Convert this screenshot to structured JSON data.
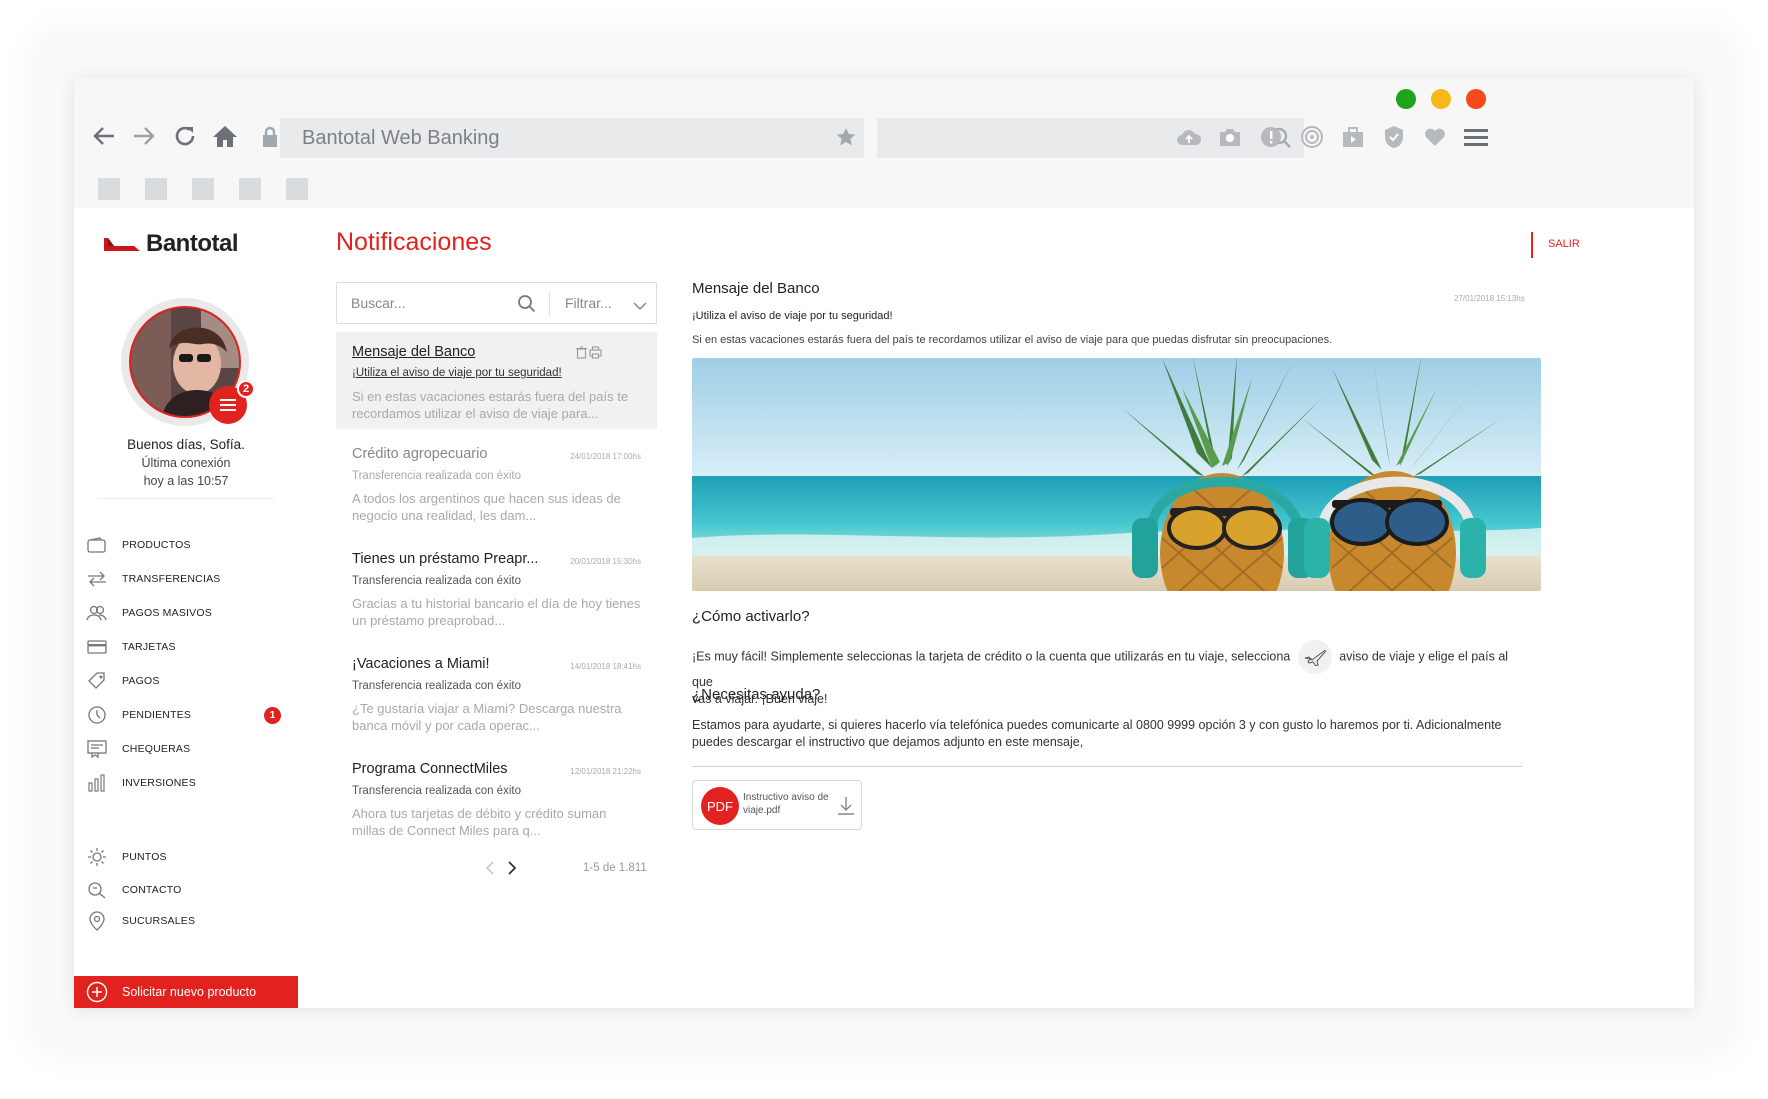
{
  "browser": {
    "address": "Bantotal Web Banking",
    "window_buttons": [
      "#1ea31e",
      "#f6b919",
      "#f54a1a"
    ]
  },
  "app": {
    "brand": "Bantotal",
    "accent": "#e2221e",
    "page_title": "Notificaciones",
    "logout": "SALIR"
  },
  "user": {
    "greeting": "Buenos días, Sofía.",
    "last_login_label": "Última conexión",
    "last_login_value": "hoy a las 10:57",
    "menu_badge": "2"
  },
  "sidebar": {
    "items": [
      {
        "label": "PRODUCTOS",
        "icon": "wallet-icon"
      },
      {
        "label": "TRANSFERENCIAS",
        "icon": "transfer-icon"
      },
      {
        "label": "PAGOS MASIVOS",
        "icon": "users-icon"
      },
      {
        "label": "TARJETAS",
        "icon": "card-icon"
      },
      {
        "label": "PAGOS",
        "icon": "tag-icon"
      },
      {
        "label": "PENDIENTES",
        "icon": "clock-icon",
        "badge": "1"
      },
      {
        "label": "CHEQUERAS",
        "icon": "checkbook-icon"
      },
      {
        "label": "INVERSIONES",
        "icon": "chart-icon"
      }
    ],
    "secondary": [
      {
        "label": "PUNTOS",
        "icon": "sun-icon"
      },
      {
        "label": "CONTACTO",
        "icon": "chat-icon"
      },
      {
        "label": "SUCURSALES",
        "icon": "location-icon"
      }
    ],
    "cta": "Solicitar nuevo producto"
  },
  "list": {
    "search_placeholder": "Buscar...",
    "filter_label": "Filtrar...",
    "items": [
      {
        "title": "Mensaje del Banco",
        "subtitle": "¡Utiliza el aviso de viaje por tu seguridad!",
        "body": "Si en estas vacaciones estarás fuera del país te recordamos utilizar el aviso de viaje para...",
        "date": ""
      },
      {
        "title": "Crédito agropecuario",
        "subtitle": "Transferencia realizada con éxito",
        "body": "A todos los argentinos que hacen sus ideas de negocio una realidad, les dam...",
        "date": "24/01/2018 17:00hs"
      },
      {
        "title": "Tienes un préstamo Preapr...",
        "subtitle": "Transferencia realizada con éxito",
        "body": "Gracias a tu historial bancario el día de hoy tienes un préstamo preaprobad...",
        "date": "20/01/2018 15:30hs"
      },
      {
        "title": "¡Vacaciones a Miami!",
        "subtitle": "Transferencia realizada con éxito",
        "body": "¿Te gustaría viajar a Miami? Descarga nuestra banca móvil y por cada operac...",
        "date": "14/01/2018 18:41hs"
      },
      {
        "title": "Programa ConnectMiles",
        "subtitle": "Transferencia realizada con éxito",
        "body": "Ahora tus tarjetas de débito y crédito suman millas de Connect Miles para q...",
        "date": "12/01/2018 21:22hs"
      }
    ],
    "pagination": "1-5 de 1.811"
  },
  "detail": {
    "title": "Mensaje del Banco",
    "date": "27/01/2018 15:13hs",
    "subtitle": "¡Utiliza el aviso de viaje por tu seguridad!",
    "intro": "Si en estas vacaciones estarás fuera del país te recordamos utilizar el aviso de viaje para que puedas disfrutar sin preocupaciones.",
    "how_title": "¿Cómo activarlo?",
    "how_text_a": "¡Es muy fácil! Simplemente seleccionas la tarjeta de crédito o la cuenta que utilizarás en tu viaje, selecciona",
    "how_text_b": "aviso de viaje y elige el país al que",
    "how_text_c": "vas a viajar. ¡Buen viaje!",
    "help_title": "¿Necesitas ayuda?",
    "help_text": "Estamos para ayudarte, si quieres hacerlo vía telefónica puedes comunicarte al 0800 9999 opción 3 y con gusto lo haremos por ti. Adicionalmente puedes descargar el instructivo que dejamos adjunto en este mensaje,",
    "attachment_type": "PDF",
    "attachment_name": "Instructivo aviso de viaje.pdf"
  }
}
